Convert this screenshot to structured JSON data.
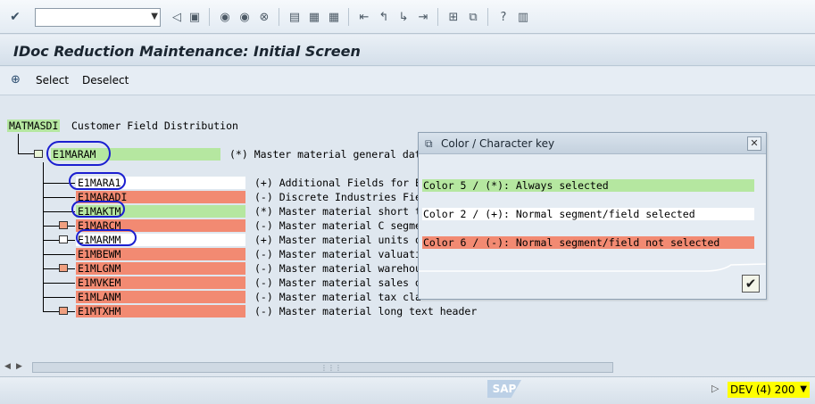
{
  "toolbar": {
    "command_field_value": "",
    "icons": [
      "enter-icon",
      "back-icon",
      "save-icon",
      "exit-icon",
      "up-icon",
      "cancel-icon",
      "print-icon",
      "find-icon",
      "find-next-icon",
      "first-page-icon",
      "previous-page-icon",
      "next-page-icon",
      "last-page-icon",
      "new-session-icon",
      "shortcut-icon",
      "help-icon",
      "layout-icon"
    ]
  },
  "title": "IDoc Reduction Maintenance: Initial Screen",
  "app_toolbar": {
    "select_label": "Select",
    "deselect_label": "Deselect"
  },
  "tree": {
    "root": {
      "label": "MATMASDI",
      "description": "Customer Field Distribution"
    },
    "level1": {
      "label": "E1MARAM",
      "description": "(*) Master material general dat"
    },
    "children": [
      {
        "label": "E1MARA1",
        "description": "(+) Additional Fields for E"
      },
      {
        "label": "E1MARADI",
        "description": "(-) Discrete Industries Fie"
      },
      {
        "label": "E1MAKTM",
        "description": "(*) Master material short t"
      },
      {
        "label": "E1MARCM",
        "description": "(-) Master material C segme"
      },
      {
        "label": "E1MARMM",
        "description": "(+) Master material units o"
      },
      {
        "label": "E1MBEWM",
        "description": "(-) Master material valuatio"
      },
      {
        "label": "E1MLGNM",
        "description": "(-) Master material warehous"
      },
      {
        "label": "E1MVKEM",
        "description": "(-) Master material sales da"
      },
      {
        "label": "E1MLANM",
        "description": "(-) Master material tax cla"
      },
      {
        "label": "E1MTXHM",
        "description": "(-) Master material long text header"
      }
    ]
  },
  "popup": {
    "title": "Color / Character key",
    "rows": [
      "Color 5 / (*): Always selected",
      "Color 2 / (+): Normal segment/field selected",
      "Color 6 / (-): Normal segment/field not selected"
    ]
  },
  "status": {
    "logo": "SAP",
    "system": "DEV (4) 200"
  },
  "colors": {
    "always_selected": "#b5e7a0",
    "normal_selected": "#ffffff",
    "not_selected": "#f28a72",
    "system_highlight": "#ffff00"
  }
}
